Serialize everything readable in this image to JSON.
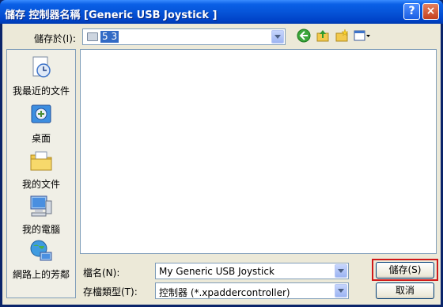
{
  "title": "儲存 控制器名稱 [Generic   USB  Joystick  ]",
  "titlebar": {
    "help": "?",
    "close": "×"
  },
  "save_in": {
    "label": "儲存於(I):",
    "value": "5 3"
  },
  "places": [
    {
      "label": "我最近的文件",
      "icon": "recent-documents-icon"
    },
    {
      "label": "桌面",
      "icon": "desktop-icon"
    },
    {
      "label": "我的文件",
      "icon": "my-documents-icon"
    },
    {
      "label": "我的電腦",
      "icon": "my-computer-icon"
    },
    {
      "label": "網路上的芳鄰",
      "icon": "network-places-icon"
    }
  ],
  "filename": {
    "label": "檔名(N):",
    "value": "My Generic   USB  Joystick"
  },
  "filetype": {
    "label": "存檔類型(T):",
    "value": "控制器 (*.xpaddercontroller)"
  },
  "buttons": {
    "save": "儲存(S)",
    "cancel": "取消"
  },
  "colors": {
    "titlebar": "#0655d9",
    "focus_ring": "#d01818",
    "dialog_bg": "#ece9d8"
  }
}
